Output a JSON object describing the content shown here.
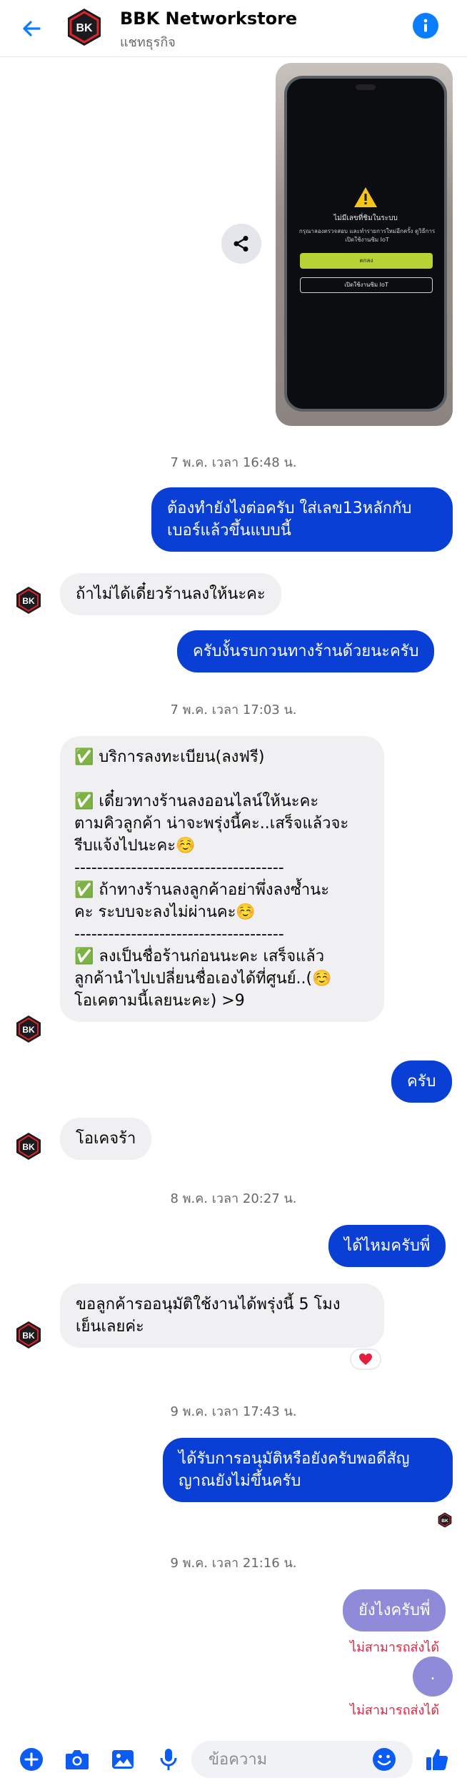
{
  "header": {
    "title": "BBK Networkstore",
    "subtitle": "แชทธุรกิจ",
    "logo_text": "BBK",
    "accent": "#0a7cff"
  },
  "media": {
    "screen_title": "ไม่มีเลขที่ชิมในระบบ",
    "screen_body": "กรุณาลองตรวจสอบ และทำรายการใหม่อีกครั้ง ดูวิธีการเปิดใช้งานซิม IoT",
    "screen_button": "ตกลง",
    "screen_button2": "เปิดใช้งานซิม IoT"
  },
  "timestamps": {
    "t1": "7 พ.ค. เวลา 16:48 น.",
    "t2": "7 พ.ค. เวลา 17:03 น.",
    "t3": "8 พ.ค. เวลา 20:27 น.",
    "t4": "9 พ.ค. เวลา 17:43 น.",
    "t5": "9 พ.ค. เวลา 21:16 น."
  },
  "messages": {
    "m1": "ต้องทำยังไงต่อครับ ใส่เลข13หลักกับ\nเบอร์แล้วขึ้นแบบนี้",
    "m2": "ถ้าไม่ได้เดี๋ยวร้านลงให้นะคะ",
    "m3": "ครับงั้นรบกวนทางร้านด้วยนะครับ",
    "m4": "✅ บริการลงทะเบียน(ลงฟรี)\n\n✅ เดี๋ยวทางร้านลงออนไลน์ให้นะคะ\nตามคิวลูกค้า น่าจะพรุ่งนี้คะ..เสร็จแล้วจะ\nรีบแจ้งไปนะคะ☺️\n-------------------------------------\n✅ ถ้าทางร้านลงลูกค้าอย่าพึ่งลงซ้ำนะ\nคะ ระบบจะลงไม่ผ่านคะ☺️\n-------------------------------------\n✅ ลงเป็นชื่อร้านก่อนนะคะ เสร็จแล้ว\nลูกค้านำไปเปลี่ยนชื่อเองได้ที่ศูนย์..(☺️\nโอเคตามนี้เลยนะคะ) >9",
    "m5": "ครับ",
    "m6": "โอเคจร้า",
    "m7": "ได้ไหมครับพี่",
    "m8": "ขอลูกค้ารออนุมัติใช้งานได้พรุ่งนี้ 5 โมง\nเย็นเลยค่ะ",
    "m9": "ได้รับการอนุมัติหรือยังครับพอดีสัญ\nญาณยังไม่ขึ้นครับ",
    "m10": "ยังไงครับพี่",
    "m11": "."
  },
  "errors": {
    "e1": "ไม่สามารถส่งได้",
    "e2": "ไม่สามารถส่งได้"
  },
  "reactions": {
    "m8": "heart"
  },
  "composer": {
    "placeholder": "ข้อความ"
  }
}
